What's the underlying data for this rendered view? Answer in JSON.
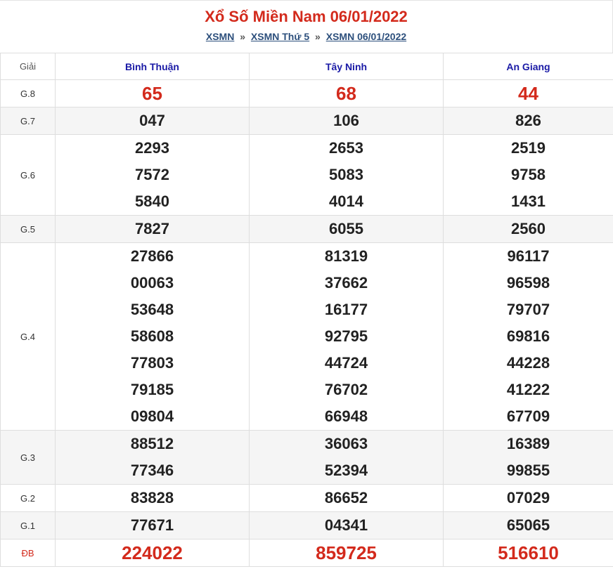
{
  "header": {
    "title": "Xổ Số Miền Nam 06/01/2022",
    "breadcrumbs": [
      "XSMN",
      "XSMN Thứ 5",
      "XSMN 06/01/2022"
    ],
    "separator": "»"
  },
  "table": {
    "giai_label": "Giải",
    "provinces": [
      "Bình Thuận",
      "Tây Ninh",
      "An Giang"
    ],
    "rows": [
      {
        "label": "G.8",
        "results": [
          [
            "65"
          ],
          [
            "68"
          ],
          [
            "44"
          ]
        ]
      },
      {
        "label": "G.7",
        "results": [
          [
            "047"
          ],
          [
            "106"
          ],
          [
            "826"
          ]
        ]
      },
      {
        "label": "G.6",
        "results": [
          [
            "2293",
            "7572",
            "5840"
          ],
          [
            "2653",
            "5083",
            "4014"
          ],
          [
            "2519",
            "9758",
            "1431"
          ]
        ]
      },
      {
        "label": "G.5",
        "results": [
          [
            "7827"
          ],
          [
            "6055"
          ],
          [
            "2560"
          ]
        ]
      },
      {
        "label": "G.4",
        "results": [
          [
            "27866",
            "00063",
            "53648",
            "58608",
            "77803",
            "79185",
            "09804"
          ],
          [
            "81319",
            "37662",
            "16177",
            "92795",
            "44724",
            "76702",
            "66948"
          ],
          [
            "96117",
            "96598",
            "79707",
            "69816",
            "44228",
            "41222",
            "67709"
          ]
        ]
      },
      {
        "label": "G.3",
        "results": [
          [
            "88512",
            "77346"
          ],
          [
            "36063",
            "52394"
          ],
          [
            "16389",
            "99855"
          ]
        ]
      },
      {
        "label": "G.2",
        "results": [
          [
            "83828"
          ],
          [
            "86652"
          ],
          [
            "07029"
          ]
        ]
      },
      {
        "label": "G.1",
        "results": [
          [
            "77671"
          ],
          [
            "04341"
          ],
          [
            "65065"
          ]
        ]
      },
      {
        "label": "ĐB",
        "results": [
          [
            "224022"
          ],
          [
            "859725"
          ],
          [
            "516610"
          ]
        ]
      }
    ]
  },
  "colors": {
    "accent_red": "#d32a1c",
    "province_blue": "#1a1aa6",
    "link": "#2c4f7c"
  }
}
